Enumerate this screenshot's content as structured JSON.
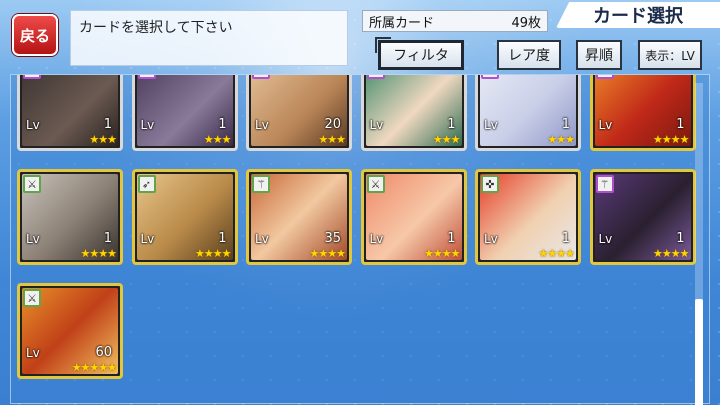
{
  "header": {
    "back_label": "戻る",
    "instruction": "カードを選択して下さい",
    "owned_label": "所属カード",
    "owned_count": "49枚",
    "title": "カード選択"
  },
  "toolbar": {
    "filter_label": "フィルタ",
    "rarity_label": "レア度",
    "order_label": "昇順",
    "display_label": "表示：LV"
  },
  "colors": {
    "frame_gold": "#e2c63e",
    "frame_silver": "#d9d9d9",
    "back_button": "#d42a2a",
    "star": "#ffd600"
  },
  "cards": [
    {
      "lv_label": "Lv",
      "level": "1",
      "stars": "★★★",
      "badge_icon": "bow-icon",
      "badge_color": "purple",
      "frame": "silver",
      "portrait": "dark-wolf"
    },
    {
      "lv_label": "Lv",
      "level": "1",
      "stars": "★★★",
      "badge_icon": "sword-icon",
      "badge_color": "purple",
      "frame": "silver",
      "portrait": "purple-wolf"
    },
    {
      "lv_label": "Lv",
      "level": "20",
      "stars": "★★★",
      "badge_icon": "staff-icon",
      "badge_color": "purple",
      "frame": "silver",
      "portrait": "glasses-man"
    },
    {
      "lv_label": "Lv",
      "level": "1",
      "stars": "★★★",
      "badge_icon": "staff-icon",
      "badge_color": "purple",
      "frame": "silver",
      "portrait": "green-hair-girl"
    },
    {
      "lv_label": "Lv",
      "level": "1",
      "stars": "★★★",
      "badge_icon": "staff-icon",
      "badge_color": "purple",
      "frame": "silver",
      "portrait": "white-hair-girl"
    },
    {
      "lv_label": "Lv",
      "level": "1",
      "stars": "★★★★",
      "badge_icon": "sword-icon",
      "badge_color": "purple",
      "frame": "gold",
      "portrait": "roaring-tiger"
    },
    {
      "lv_label": "Lv",
      "level": "1",
      "stars": "★★★★",
      "badge_icon": "sword-icon",
      "badge_color": "green",
      "frame": "gold",
      "portrait": "grey-beard-man"
    },
    {
      "lv_label": "Lv",
      "level": "1",
      "stars": "★★★★",
      "badge_icon": "bow-icon",
      "badge_color": "green",
      "frame": "gold",
      "portrait": "tanuki-man"
    },
    {
      "lv_label": "Lv",
      "level": "35",
      "stars": "★★★★",
      "badge_icon": "staff-icon",
      "badge_color": "green",
      "frame": "gold",
      "portrait": "winking-boy"
    },
    {
      "lv_label": "Lv",
      "level": "1",
      "stars": "★★★★",
      "badge_icon": "sword-icon",
      "badge_color": "green",
      "frame": "gold",
      "portrait": "pink-hair-boy"
    },
    {
      "lv_label": "Lv",
      "level": "1",
      "stars": "★★★★",
      "badge_icon": "gun-icon",
      "badge_color": "green",
      "frame": "gold",
      "portrait": "red-hair-man"
    },
    {
      "lv_label": "Lv",
      "level": "1",
      "stars": "★★★★",
      "badge_icon": "staff-icon",
      "badge_color": "purple",
      "frame": "gold",
      "portrait": "purple-beast"
    },
    {
      "lv_label": "Lv",
      "level": "60",
      "stars": "★★★★★",
      "badge_icon": "sword-icon",
      "badge_color": "green",
      "frame": "gold",
      "portrait": "lion-man"
    }
  ]
}
